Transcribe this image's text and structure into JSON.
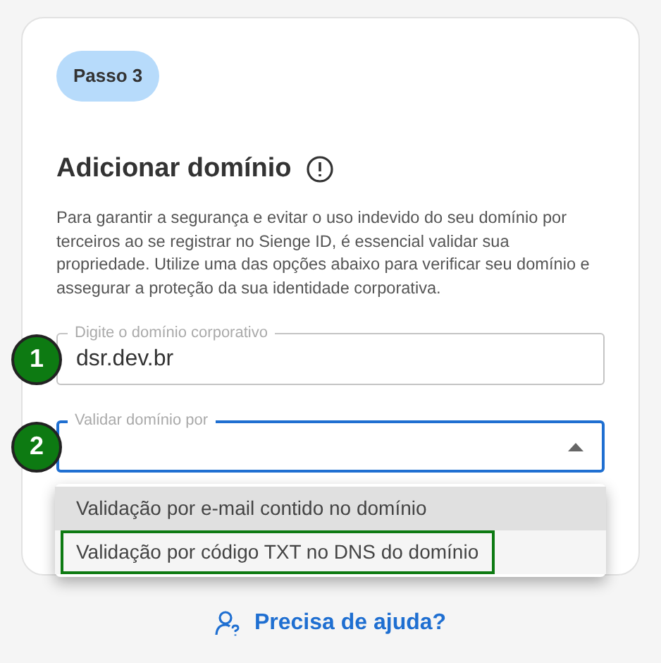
{
  "badge": "Passo 3",
  "title": "Adicionar domínio",
  "description": "Para garantir a segurança e evitar o uso indevido do seu domínio por terceiros ao se registrar no Sienge ID, é essencial validar sua propriedade. Utilize uma das opções abaixo para verificar seu domínio e assegurar a proteção da sua identidade corporativa.",
  "fields": [
    {
      "kind": "text",
      "label": "Digite o domínio corporativo",
      "value": "dsr.dev.br",
      "focused": false,
      "marker": "1"
    },
    {
      "kind": "select",
      "label": "Validar domínio por",
      "focused": true,
      "expanded": true,
      "marker": "2",
      "options": [
        {
          "label": "Validação por e-mail contido no domínio",
          "highlighted": true,
          "annotated": false
        },
        {
          "label": "Validação por código TXT no DNS do domínio",
          "highlighted": false,
          "annotated": true
        }
      ]
    }
  ],
  "help_link": "Precisa de ajuda?"
}
